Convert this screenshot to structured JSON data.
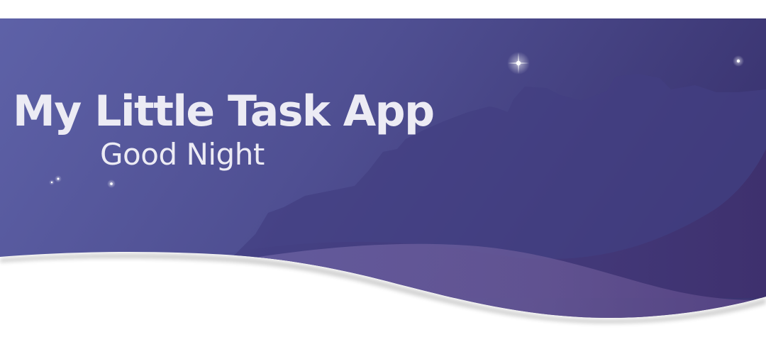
{
  "header": {
    "title": "My Little Task App",
    "greeting": "Good Night"
  },
  "colors": {
    "sky_left": "#5e62a8",
    "sky_right": "#3d3674",
    "mountain": "#403f82",
    "wave_back": "#6f5f9c",
    "wave_front": "#4a3d78",
    "text": "#ecebf4",
    "background": "#ffffff"
  }
}
